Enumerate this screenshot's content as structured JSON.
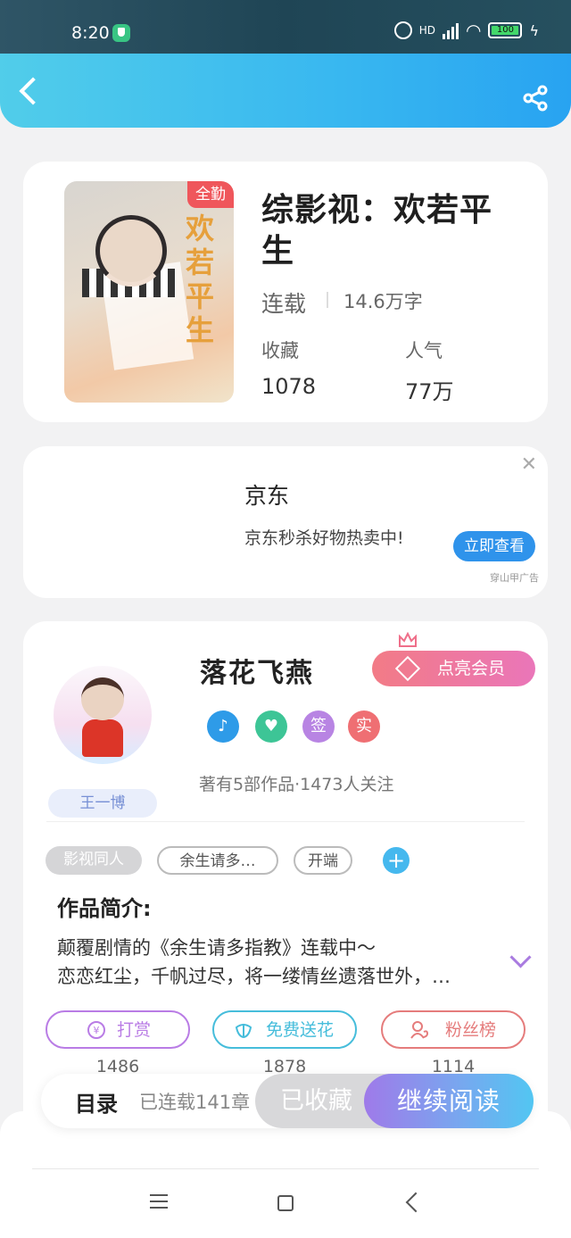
{
  "status_bar": {
    "time": "8:20",
    "network": "HD",
    "battery": "100"
  },
  "book": {
    "title": "综影视：欢若平生",
    "cover_title": "欢若平生",
    "cover_badge": "全勤",
    "status": "连载",
    "words": "14.6万字",
    "favorites_label": "收藏",
    "favorites_value": "1078",
    "popularity_label": "人气",
    "popularity_value": "77万"
  },
  "ad": {
    "title": "京东",
    "text": "京东秒杀好物热卖中!",
    "button": "立即查看",
    "source": "穿山甲广告"
  },
  "author": {
    "name": "落花飞燕",
    "tag": "王一博",
    "vip_button": "点亮会员",
    "badges": [
      "♪",
      "♥",
      "签",
      "实"
    ],
    "meta": "著有5部作品·1473人关注",
    "chips": [
      "影视同人",
      "余生请多…",
      "开端"
    ],
    "intro_title": "作品简介:",
    "intro_lines": [
      "颠覆剧情的《余生请多指教》连载中～",
      "恋恋红尘，千帆过尽，将一缕情丝遗落世外，…"
    ]
  },
  "actions": [
    {
      "label": "打赏",
      "count": "1486",
      "icon": "coin-icon",
      "color": "#b97ce5"
    },
    {
      "label": "免费送花",
      "count": "1878",
      "icon": "flower-icon",
      "color": "#46bddb"
    },
    {
      "label": "粉丝榜",
      "count": "1114",
      "icon": "fan-icon",
      "color": "#e57c7c"
    }
  ],
  "bottom_bar": {
    "toc": "目录",
    "chapter_count": "已连载141章",
    "collected": "已收藏",
    "continue": "继续阅读"
  }
}
